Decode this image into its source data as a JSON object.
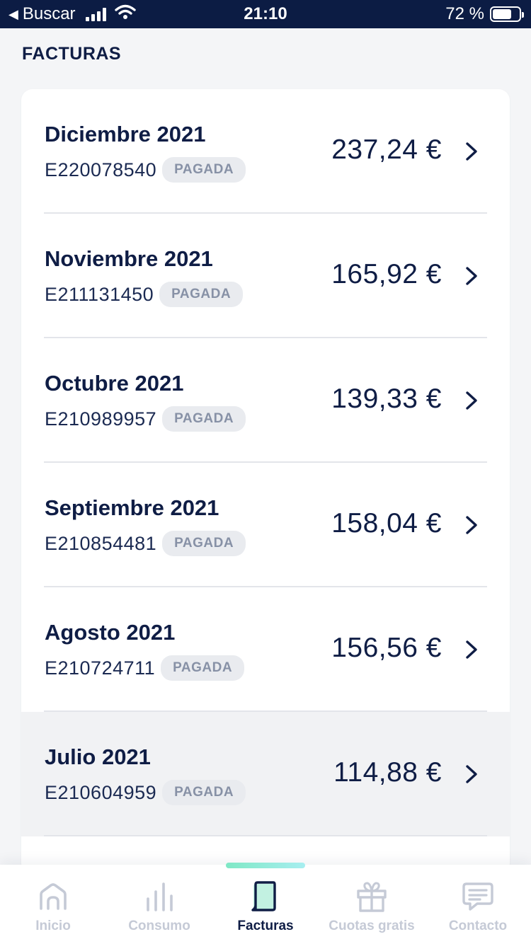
{
  "status_bar": {
    "back_label": "Buscar",
    "time": "21:10",
    "battery_text": "72 %",
    "battery_level": 0.72
  },
  "page": {
    "title": "FACTURAS"
  },
  "invoices": [
    {
      "month": "Diciembre 2021",
      "id": "E220078540",
      "status": "PAGADA",
      "amount": "237,24 €"
    },
    {
      "month": "Noviembre 2021",
      "id": "E211131450",
      "status": "PAGADA",
      "amount": "165,92 €"
    },
    {
      "month": "Octubre 2021",
      "id": "E210989957",
      "status": "PAGADA",
      "amount": "139,33 €"
    },
    {
      "month": "Septiembre 2021",
      "id": "E210854481",
      "status": "PAGADA",
      "amount": "158,04 €"
    },
    {
      "month": "Agosto 2021",
      "id": "E210724711",
      "status": "PAGADA",
      "amount": "156,56 €"
    },
    {
      "month": "Julio 2021",
      "id": "E210604959",
      "status": "PAGADA",
      "amount": "114,88 €"
    }
  ],
  "tabs": [
    {
      "label": "Inicio",
      "icon": "home-icon",
      "active": false
    },
    {
      "label": "Consumo",
      "icon": "bar-chart-icon",
      "active": false
    },
    {
      "label": "Facturas",
      "icon": "invoice-icon",
      "active": true
    },
    {
      "label": "Cuotas gratis",
      "icon": "gift-icon",
      "active": false
    },
    {
      "label": "Contacto",
      "icon": "chat-icon",
      "active": false
    }
  ],
  "colors": {
    "navy": "#0f1d45",
    "status_bar_bg": "#0c1c44",
    "badge_bg": "#e9ebef",
    "badge_text": "#8791a6",
    "accent_mint": "#7fe8c5",
    "inactive_tab": "#c5cad6"
  }
}
